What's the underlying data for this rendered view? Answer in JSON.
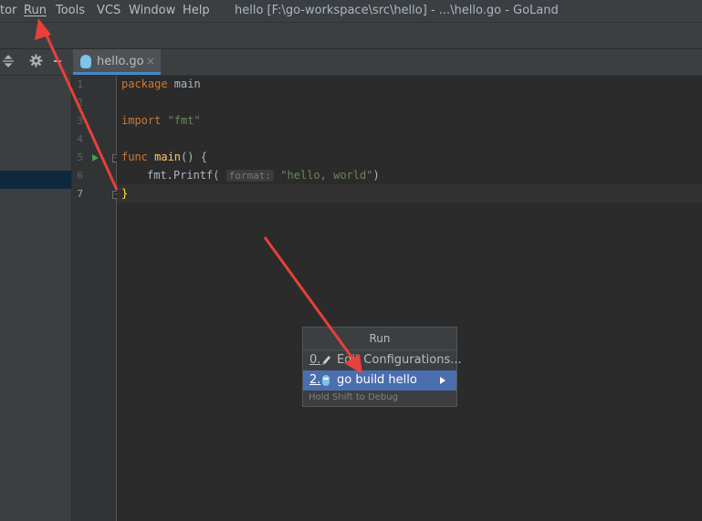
{
  "menubar": {
    "items": [
      "tor",
      "Run",
      "Tools",
      "VCS",
      "Window",
      "Help"
    ],
    "title": "hello [F:\\go-workspace\\src\\hello] - ...\\hello.go - GoLand"
  },
  "toolbar": {
    "icons": [
      "collapse-icon",
      "gear-icon",
      "hide-icon"
    ]
  },
  "tab": {
    "label": "hello.go",
    "close": "×",
    "icon": "gopher-file-icon"
  },
  "gutter": {
    "line_numbers": [
      "1",
      "2",
      "3",
      "4",
      "5",
      "6",
      "7"
    ],
    "current_line": "7"
  },
  "code": {
    "line1": {
      "keyword": "package",
      "name": " main"
    },
    "line3": {
      "keyword": "import",
      "string": " \"fmt\""
    },
    "line5": {
      "keyword": "func",
      "name": " main",
      "rest": "() {"
    },
    "line6": {
      "call": "fmt.Printf(",
      "hint": "format:",
      "string": " \"hello, world\"",
      "close": ")"
    },
    "line7": {
      "brace": "}"
    }
  },
  "run_popup": {
    "title": "Run",
    "items": [
      {
        "mnemonic": "0.",
        "label": "Edit Configurations...",
        "icon": "pencil-icon"
      },
      {
        "mnemonic": "2.",
        "label": "go build hello",
        "icon": "gopher-icon",
        "has_submenu": true
      }
    ],
    "footer": "Hold Shift to Debug"
  },
  "colors": {
    "accent": "#4b6eaf",
    "annotation_arrow": "#e8403a",
    "run_marker": "#499c54"
  }
}
